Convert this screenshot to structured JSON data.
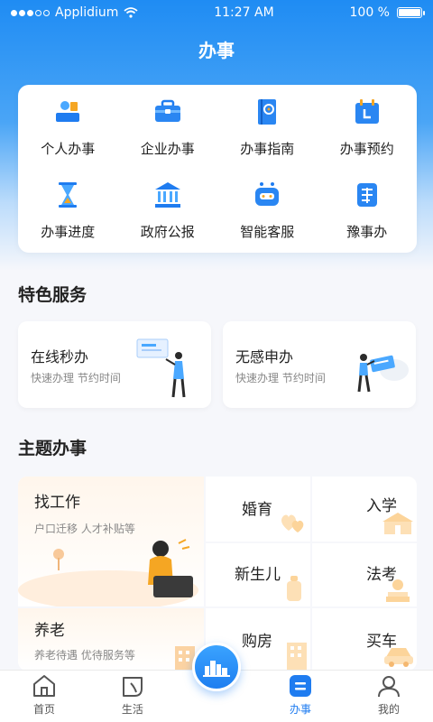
{
  "status_bar": {
    "carrier": "Applidium",
    "time": "11:27 AM",
    "battery": "100 %",
    "battery_level": 1.0
  },
  "header": {
    "title": "办事"
  },
  "services": [
    {
      "label": "个人办事",
      "icon": "person-desk-icon"
    },
    {
      "label": "企业办事",
      "icon": "briefcase-icon"
    },
    {
      "label": "办事指南",
      "icon": "guide-book-icon"
    },
    {
      "label": "办事预约",
      "icon": "calendar-icon"
    },
    {
      "label": "办事进度",
      "icon": "hourglass-icon"
    },
    {
      "label": "政府公报",
      "icon": "government-building-icon"
    },
    {
      "label": "智能客服",
      "icon": "robot-icon"
    },
    {
      "label": "豫事办",
      "icon": "yu-badge-icon"
    }
  ],
  "featured": {
    "title": "特色服务",
    "cards": [
      {
        "title": "在线秒办",
        "subtitle": "快速办理 节约时间"
      },
      {
        "title": "无感申办",
        "subtitle": "快速办理 节约时间"
      }
    ]
  },
  "topics": {
    "title": "主题办事",
    "job": {
      "title": "找工作",
      "subtitle": "户口迁移 人才补贴等"
    },
    "pension": {
      "title": "养老",
      "subtitle": "养老待遇 优待服务等"
    },
    "marriage": {
      "title": "婚育"
    },
    "school": {
      "title": "入学"
    },
    "newborn": {
      "title": "新生儿"
    },
    "law_exam": {
      "title": "法考"
    },
    "house": {
      "title": "购房"
    },
    "car": {
      "title": "买车"
    }
  },
  "nav": {
    "items": [
      {
        "label": "首页",
        "icon": "home-icon"
      },
      {
        "label": "生活",
        "icon": "leaf-icon"
      },
      {
        "label": "办事",
        "icon": "service-icon",
        "active": true
      },
      {
        "label": "我的",
        "icon": "profile-icon"
      }
    ]
  },
  "colors": {
    "brand_blue": "#1f7cf0",
    "accent_orange": "#f5a623"
  }
}
